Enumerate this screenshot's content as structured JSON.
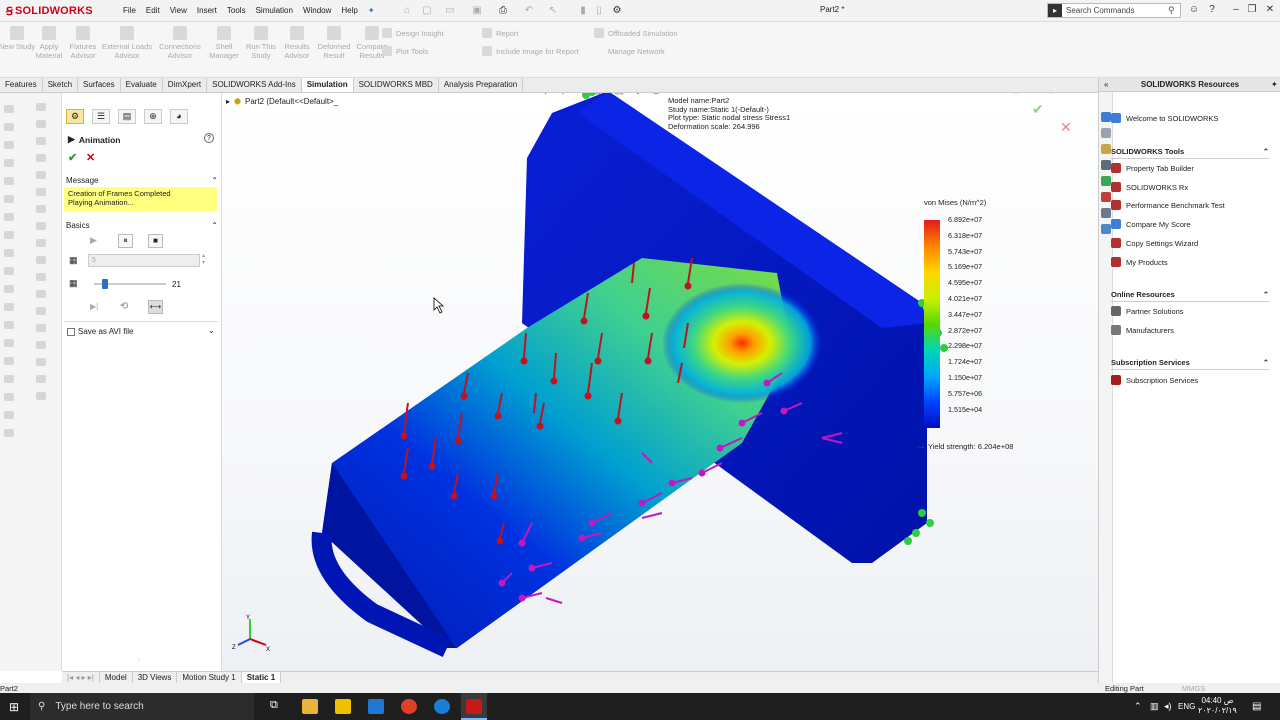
{
  "app": {
    "brand": "SOLIDWORKS",
    "document_title": "Part2 *",
    "menus": [
      "File",
      "Edit",
      "View",
      "Insert",
      "Tools",
      "Simulation",
      "Window",
      "Help"
    ],
    "search_placeholder": "Search Commands"
  },
  "commands": {
    "big": [
      {
        "label": "New Study"
      },
      {
        "label": "Apply Material"
      },
      {
        "label": "Fixtures Advisor"
      },
      {
        "label": "External Loads Advisor"
      },
      {
        "label": "Connections Advisor"
      },
      {
        "label": "Shell Manager"
      },
      {
        "label": "Run This Study"
      },
      {
        "label": "Results Advisor"
      },
      {
        "label": "Deformed Result"
      },
      {
        "label": "Compare Results"
      }
    ],
    "small": {
      "design_insight": "Design Insight",
      "plot_tools": "Plot Tools",
      "report": "Report",
      "include_image": "Include Image for Report",
      "offloaded": "Offloaded Simulation",
      "manage_network": "Manage Network"
    }
  },
  "tabs": [
    "Features",
    "Sketch",
    "Surfaces",
    "Evaluate",
    "DimXpert",
    "SOLIDWORKS Add-Ins",
    "Simulation",
    "SOLIDWORKS MBD",
    "Analysis Preparation"
  ],
  "active_tab": "Simulation",
  "property_manager": {
    "title": "Animation",
    "help": "?",
    "message_header": "Message",
    "message_line1": "Creation of Frames Completed",
    "message_line2": "Playing Animation...",
    "basics_header": "Basics",
    "frames_value": "5",
    "speed_value": "21",
    "speed_fraction": 0.15,
    "save_avi_label": "Save as AVI file"
  },
  "viewport": {
    "feature_tree_label": "Part2  (Default<<Default>_",
    "plot_info": {
      "model_name": "Model name:Part2",
      "study_name": "Study name:Static 1(-Default-)",
      "plot_type": "Plot type: Static nodal stress Stress1",
      "deformation_scale": "Deformation scale: 264.996"
    },
    "legend_title": "von Mises (N/m^2)",
    "legend_ticks": [
      "6.892e+07",
      "6.318e+07",
      "5.743e+07",
      "5.169e+07",
      "4.595e+07",
      "4.021e+07",
      "3.447e+07",
      "2.872e+07",
      "2.298e+07",
      "1.724e+07",
      "1.150e+07",
      "5.757e+06",
      "1.515e+04"
    ],
    "yield_label": "Yield strength: 6.204e+08"
  },
  "bottom_tabs": [
    "Model",
    "3D Views",
    "Motion Study 1",
    "Static 1"
  ],
  "active_bottom_tab": "Static 1",
  "status": {
    "left": "Part2",
    "mode": "Editing Part",
    "units": "MMGS"
  },
  "task_pane": {
    "title": "SOLIDWORKS Resources",
    "welcome": "Welcome to SOLIDWORKS",
    "tools_header": "SOLIDWORKS Tools",
    "tools": [
      "Property Tab Builder",
      "SOLIDWORKS Rx",
      "Performance Benchmark Test",
      "Compare My Score",
      "Copy Settings Wizard",
      "My Products"
    ],
    "online_header": "Online Resources",
    "online": [
      "Partner Solutions",
      "Manufacturers"
    ],
    "subscription_header": "Subscription Services",
    "subscription": [
      "Subscription Services"
    ]
  },
  "taskbar": {
    "search_placeholder": "Type here to search",
    "lang": "ENG",
    "time": "04:40 ص",
    "date": "٢٠٢٠/٠٢/١٩"
  },
  "colors": {
    "brand_red": "#d0021b",
    "stress_max": "#e31a1c",
    "stress_min": "#0010c0",
    "load_arrow": "#c1121f",
    "fixture_arrow": "#2ecc40",
    "pressure_arrow": "#c218c2"
  }
}
